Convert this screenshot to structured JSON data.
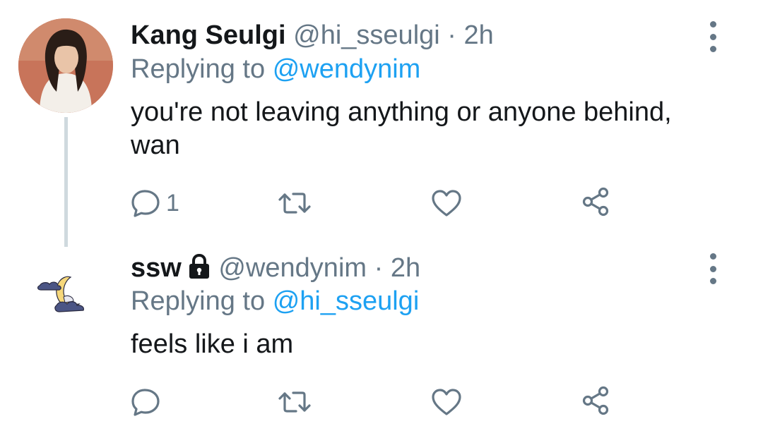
{
  "tweets": [
    {
      "display_name": "Kang Seulgi",
      "handle": "@hi_sseulgi",
      "separator": "·",
      "time": "2h",
      "replying_prefix": "Replying to",
      "replying_to": "@wendynim",
      "text": "you're not leaving anything or anyone behind, wan",
      "reply_count": "1",
      "protected": false
    },
    {
      "display_name": "ssw",
      "handle": "@wendynim",
      "separator": "·",
      "time": "2h",
      "replying_prefix": "Replying to",
      "replying_to": "@hi_sseulgi",
      "text": "feels like i am",
      "reply_count": "",
      "protected": true
    }
  ],
  "icons": {
    "reply": "reply-icon",
    "retweet": "retweet-icon",
    "like": "like-icon",
    "share": "share-icon",
    "more": "more-options-icon",
    "lock": "lock-icon"
  },
  "colors": {
    "link": "#1da1f2",
    "secondary_text": "#657786",
    "primary_text": "#14171a",
    "thread_line": "#cfd9de"
  }
}
